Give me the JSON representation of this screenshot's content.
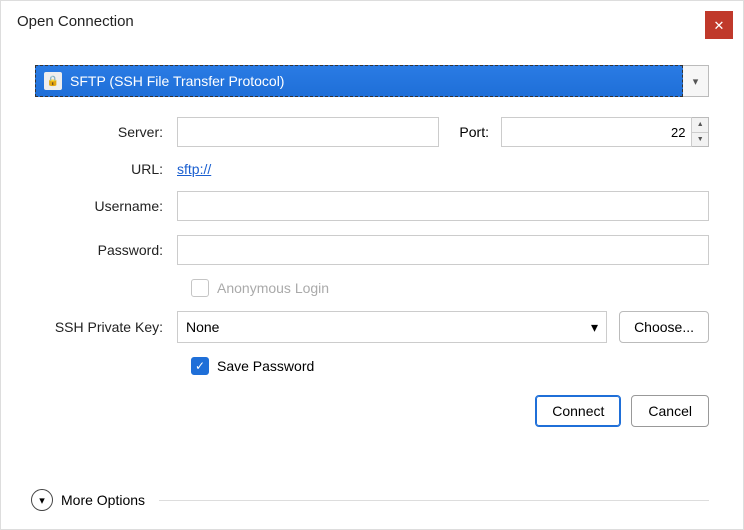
{
  "window": {
    "title": "Open Connection"
  },
  "protocol": {
    "selected": "SFTP (SSH File Transfer Protocol)"
  },
  "labels": {
    "server": "Server:",
    "port": "Port:",
    "url": "URL:",
    "username": "Username:",
    "password": "Password:",
    "ssh_key": "SSH Private Key:"
  },
  "values": {
    "server": "",
    "port": "22",
    "url": "sftp://",
    "username": "",
    "password": "",
    "ssh_key_selected": "None"
  },
  "checkboxes": {
    "anonymous": {
      "label": "Anonymous Login",
      "checked": false
    },
    "save_password": {
      "label": "Save Password",
      "checked": true
    }
  },
  "buttons": {
    "choose": "Choose...",
    "connect": "Connect",
    "cancel": "Cancel",
    "more": "More Options"
  }
}
